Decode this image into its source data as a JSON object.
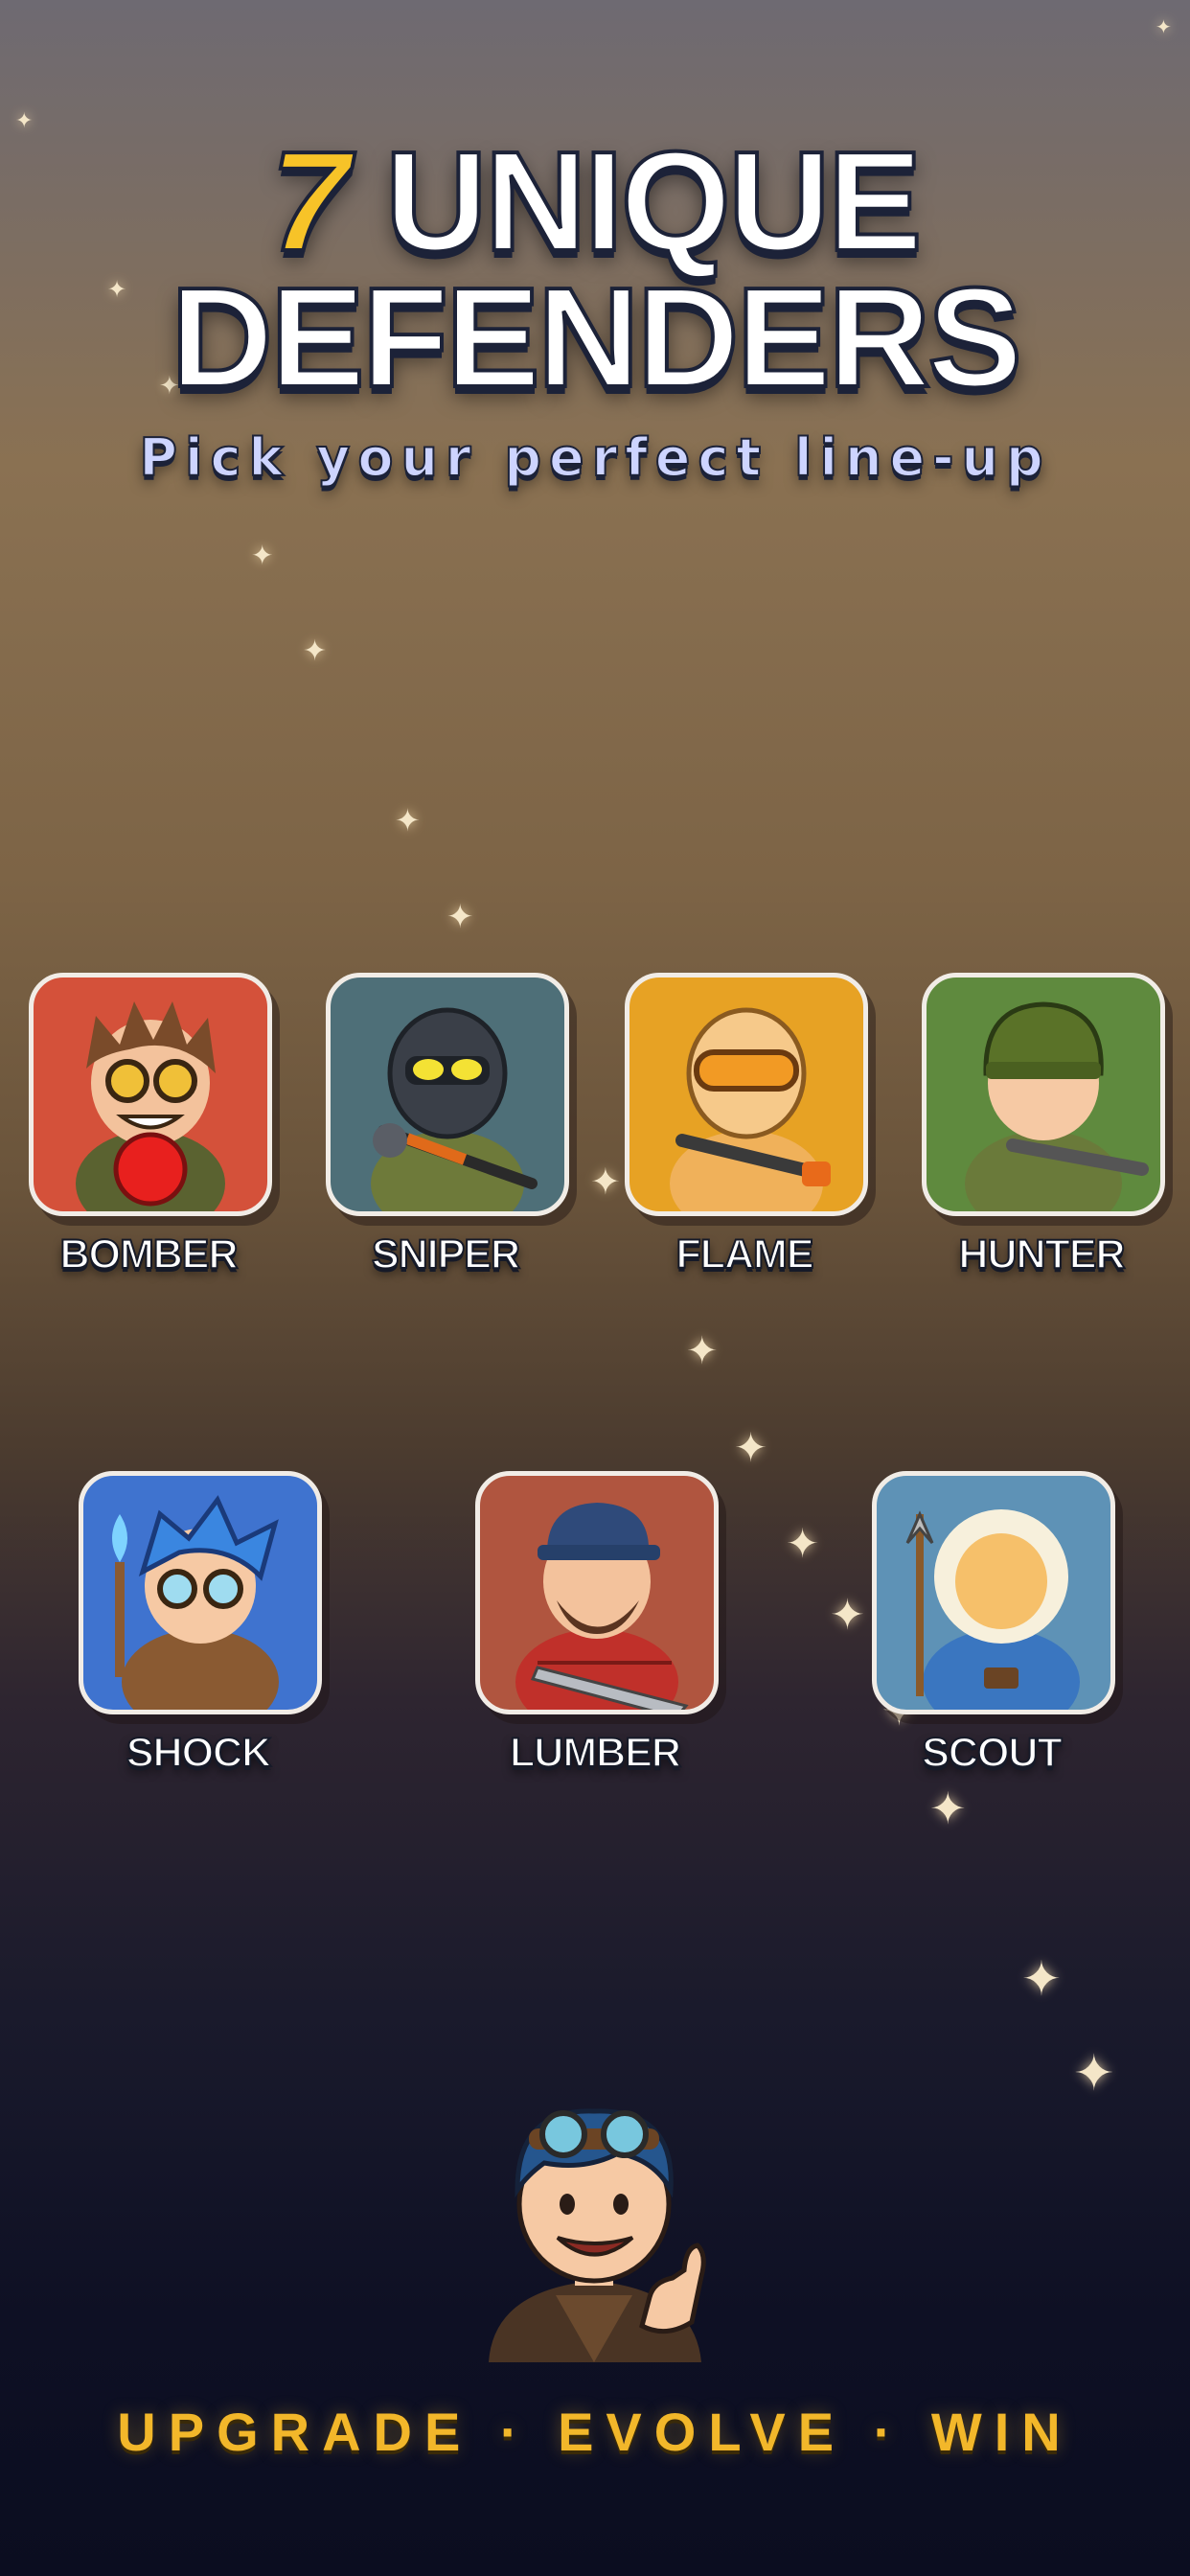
{
  "headline": {
    "number": "7",
    "line1_word": "UNIQUE",
    "line2": "DEFENDERS"
  },
  "subtitle": "Pick your perfect line-up",
  "tagline": "UPGRADE · EVOLVE · WIN",
  "defenders": [
    {
      "name": "BOMBER",
      "tile_color": "#d4513a",
      "icon": "bomber-portrait"
    },
    {
      "name": "SNIPER",
      "tile_color": "#4e6f78",
      "icon": "sniper-portrait"
    },
    {
      "name": "FLAME",
      "tile_color": "#e7a224",
      "icon": "flame-portrait"
    },
    {
      "name": "HUNTER",
      "tile_color": "#5f8a3e",
      "icon": "hunter-portrait"
    },
    {
      "name": "SHOCK",
      "tile_color": "#3f73cf",
      "icon": "shock-portrait"
    },
    {
      "name": "LUMBER",
      "tile_color": "#b0553f",
      "icon": "lumber-portrait"
    },
    {
      "name": "SCOUT",
      "tile_color": "#5e92b6",
      "icon": "scout-portrait"
    }
  ],
  "colors": {
    "accent_yellow": "#f7c328",
    "tagline": "#f2b72a",
    "subtitle": "#cdd4ff"
  }
}
